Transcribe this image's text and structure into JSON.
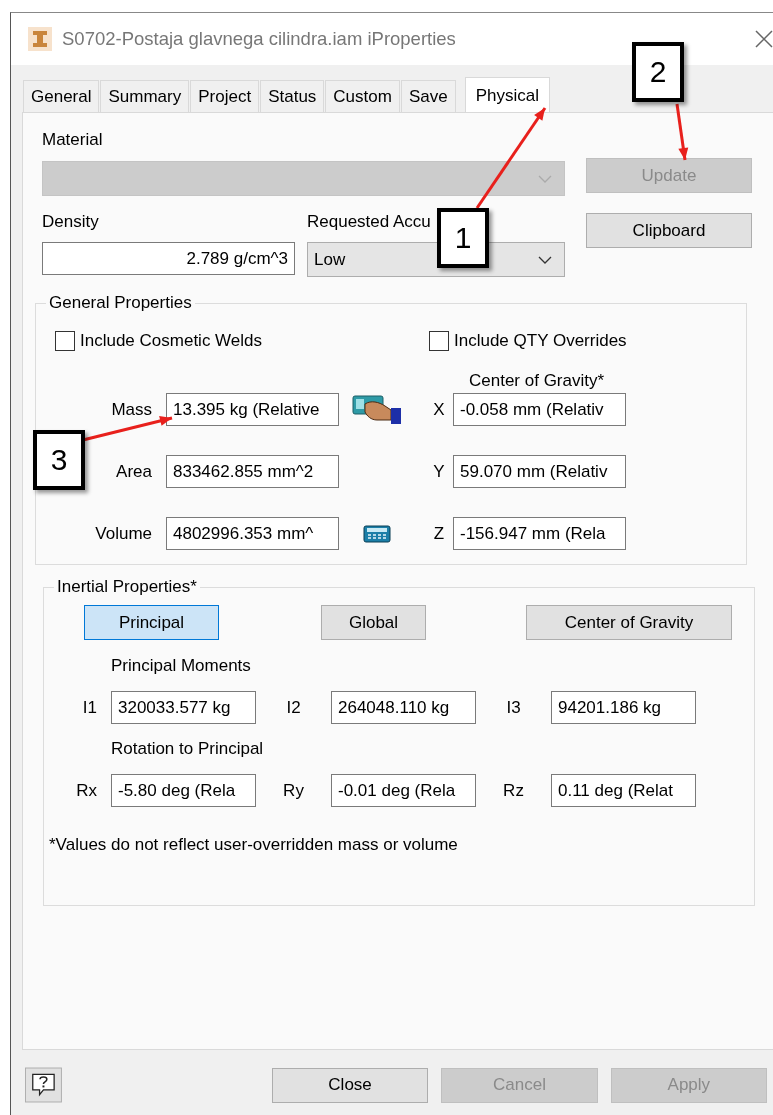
{
  "window": {
    "title": "S0702-Postaja glavnega cilindra.iam iProperties"
  },
  "tabs": [
    {
      "label": "General",
      "selected": false
    },
    {
      "label": "Summary",
      "selected": false
    },
    {
      "label": "Project",
      "selected": false
    },
    {
      "label": "Status",
      "selected": false
    },
    {
      "label": "Custom",
      "selected": false
    },
    {
      "label": "Save",
      "selected": false
    },
    {
      "label": "Physical",
      "selected": true
    }
  ],
  "material": {
    "label": "Material",
    "disabled": true
  },
  "side_buttons": [
    {
      "label": "Update",
      "disabled": true
    },
    {
      "label": "Clipboard",
      "disabled": false
    }
  ],
  "density": {
    "label": "Density",
    "value": "2.789 g/cm^3"
  },
  "accuracy": {
    "label": "Requested Accu",
    "value": "Low"
  },
  "general_properties": {
    "title": "General Properties",
    "checkboxes": [
      {
        "label": "Include Cosmetic Welds",
        "checked": false
      },
      {
        "label": "Include QTY Overrides",
        "checked": false
      }
    ],
    "center_of_gravity_title": "Center of Gravity*",
    "rows": [
      {
        "label": "Mass",
        "value": "13.395 kg (Relative",
        "axis": "X",
        "axis_value": "-0.058 mm (Relativ"
      },
      {
        "label": "Area",
        "value": "833462.855 mm^2",
        "axis": "Y",
        "axis_value": "59.070 mm (Relativ"
      },
      {
        "label": "Volume",
        "value": "4802996.353 mm^",
        "axis": "Z",
        "axis_value": "-156.947 mm (Rela"
      }
    ]
  },
  "inertial_properties": {
    "title": "Inertial Properties*",
    "modes": [
      {
        "label": "Principal",
        "selected": true
      },
      {
        "label": "Global",
        "selected": false
      },
      {
        "label": "Center of Gravity",
        "selected": false
      }
    ],
    "moments_title": "Principal Moments",
    "moments": [
      {
        "label": "I1",
        "value": "320033.577 kg"
      },
      {
        "label": "I2",
        "value": "264048.110 kg"
      },
      {
        "label": "I3",
        "value": "94201.186 kg"
      }
    ],
    "rotation_title": "Rotation to Principal",
    "rotations": [
      {
        "label": "Rx",
        "value": "-5.80 deg (Rela"
      },
      {
        "label": "Ry",
        "value": "-0.01 deg (Rela"
      },
      {
        "label": "Rz",
        "value": "0.11 deg (Relat"
      }
    ],
    "note": "*Values do not reflect user-overridden mass or volume"
  },
  "footer_buttons": [
    {
      "label": "Close",
      "disabled": false
    },
    {
      "label": "Cancel",
      "disabled": true
    },
    {
      "label": "Apply",
      "disabled": true
    }
  ],
  "callouts": [
    {
      "number": "1"
    },
    {
      "number": "2"
    },
    {
      "number": "3"
    }
  ]
}
